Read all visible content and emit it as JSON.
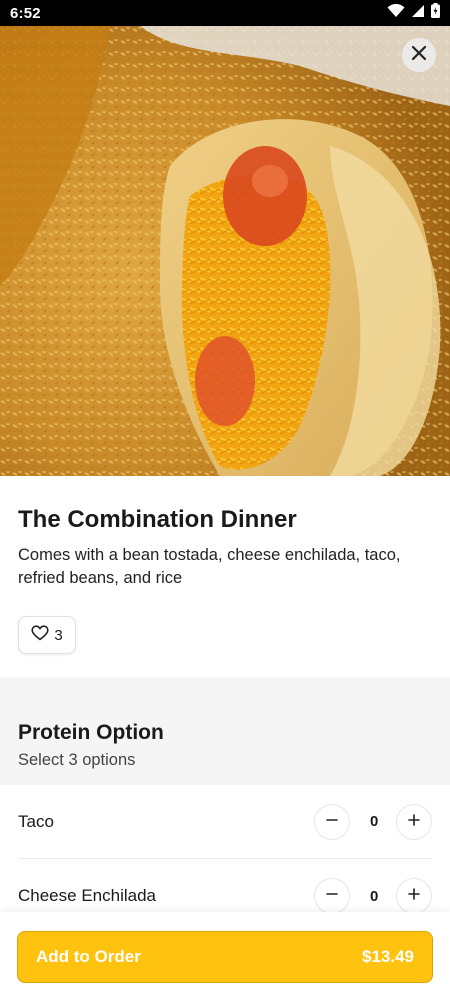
{
  "status_bar": {
    "time": "6:52",
    "icons": [
      "wifi-icon",
      "signal-icon",
      "battery-icon"
    ]
  },
  "hero": {
    "close_icon": "close-icon"
  },
  "item": {
    "title": "The Combination Dinner",
    "description": "Comes with a bean tostada, cheese enchilada, taco, refried beans, and rice",
    "likes": "3",
    "like_icon": "heart-icon"
  },
  "options": {
    "title": "Protein Option",
    "subtitle": "Select 3 options",
    "rows": [
      {
        "label": "Taco",
        "qty": "0"
      },
      {
        "label": "Cheese Enchilada",
        "qty": "0"
      }
    ]
  },
  "cta": {
    "label": "Add to Order",
    "price": "$13.49",
    "color": "#ffc20e"
  }
}
